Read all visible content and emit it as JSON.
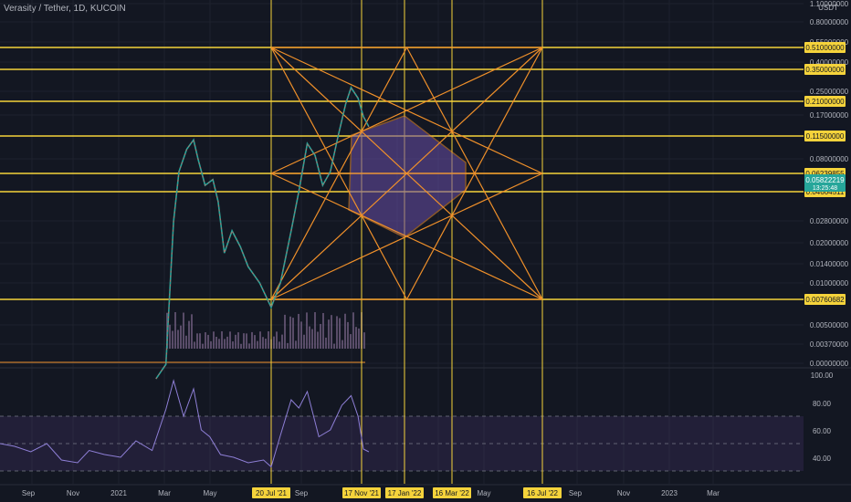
{
  "header": {
    "title": "Verasity / Tether, 1D, KUCOIN",
    "currency": "USDT"
  },
  "colors": {
    "background": "#131722",
    "grid": "#1e222d",
    "level": "#f5d33b",
    "star": "#f0902a",
    "fill": "#6a4fa8",
    "rsi": "#8e7fd6",
    "rsi_band": "#7e57c2",
    "badge_text": "#131722",
    "price_badge": "#26a69a",
    "axis_text": "#b2b5be",
    "volume": "#6b5a7a"
  },
  "chart_data": {
    "type": "line",
    "title": "Verasity / Tether, 1D, KUCOIN",
    "price_axis": {
      "scale": "log",
      "ticks": [
        "1.10000000",
        "0.80000000",
        "0.55000000",
        "0.40000000",
        "0.25000000",
        "0.17000000",
        "0.08000000",
        "0.02800000",
        "0.02000000",
        "0.01400000",
        "0.01000000",
        "0.00500000",
        "0.00370000",
        "0.00000000"
      ]
    },
    "levels": [
      "0.51000000",
      "0.35000000",
      "0.21000000",
      "0.11500000",
      "0.06239855",
      "0.04664511",
      "0.00760682"
    ],
    "current_price": {
      "value": "0.05822219",
      "countdown": "13:25:48"
    },
    "rsi_axis": {
      "ticks": [
        "100.00",
        "80.00",
        "60.00",
        "40.00"
      ],
      "band": [
        30,
        70
      ]
    },
    "time_axis": [
      "Sep",
      "Nov",
      "2021",
      "Mar",
      "May",
      "Sep",
      "Jan",
      "Mar",
      "May",
      "Sep",
      "Nov",
      "2023",
      "Mar"
    ],
    "date_markers": [
      "20 Jul '21",
      "17 Nov '21",
      "17 Jan '22",
      "16 Mar '22",
      "16 Jul '22"
    ],
    "series": [
      {
        "name": "price",
        "points": [
          [
            "2021-02-20",
            0.0034
          ],
          [
            "2021-03-05",
            0.004
          ],
          [
            "2021-03-15",
            0.02
          ],
          [
            "2021-03-22",
            0.035
          ],
          [
            "2021-04-01",
            0.045
          ],
          [
            "2021-04-10",
            0.05
          ],
          [
            "2021-04-16",
            0.04
          ],
          [
            "2021-04-25",
            0.03
          ],
          [
            "2021-05-05",
            0.032
          ],
          [
            "2021-05-12",
            0.025
          ],
          [
            "2021-05-20",
            0.014
          ],
          [
            "2021-05-30",
            0.018
          ],
          [
            "2021-06-10",
            0.015
          ],
          [
            "2021-06-20",
            0.012
          ],
          [
            "2021-07-05",
            0.01
          ],
          [
            "2021-07-20",
            0.0076
          ],
          [
            "2021-08-01",
            0.01
          ],
          [
            "2021-08-15",
            0.018
          ],
          [
            "2021-08-25",
            0.028
          ],
          [
            "2021-09-05",
            0.048
          ],
          [
            "2021-09-15",
            0.042
          ],
          [
            "2021-09-25",
            0.03
          ],
          [
            "2021-10-05",
            0.035
          ],
          [
            "2021-10-15",
            0.052
          ],
          [
            "2021-10-25",
            0.075
          ],
          [
            "2021-11-01",
            0.09
          ],
          [
            "2021-11-10",
            0.08
          ],
          [
            "2021-11-17",
            0.065
          ],
          [
            "2021-11-24",
            0.058
          ]
        ]
      },
      {
        "name": "rsi",
        "points": [
          [
            "2020-08-01",
            50
          ],
          [
            "2020-08-20",
            48
          ],
          [
            "2020-09-10",
            44
          ],
          [
            "2020-10-01",
            50
          ],
          [
            "2020-10-20",
            38
          ],
          [
            "2020-11-10",
            36
          ],
          [
            "2020-11-25",
            45
          ],
          [
            "2020-12-15",
            42
          ],
          [
            "2021-01-05",
            40
          ],
          [
            "2021-01-25",
            52
          ],
          [
            "2021-02-15",
            45
          ],
          [
            "2021-03-05",
            75
          ],
          [
            "2021-03-15",
            96
          ],
          [
            "2021-03-28",
            70
          ],
          [
            "2021-04-10",
            90
          ],
          [
            "2021-04-20",
            60
          ],
          [
            "2021-05-01",
            55
          ],
          [
            "2021-05-15",
            42
          ],
          [
            "2021-06-01",
            40
          ],
          [
            "2021-06-20",
            36
          ],
          [
            "2021-07-10",
            38
          ],
          [
            "2021-07-20",
            33
          ],
          [
            "2021-08-01",
            56
          ],
          [
            "2021-08-15",
            82
          ],
          [
            "2021-08-25",
            76
          ],
          [
            "2021-09-05",
            88
          ],
          [
            "2021-09-20",
            55
          ],
          [
            "2021-10-05",
            60
          ],
          [
            "2021-10-20",
            78
          ],
          [
            "2021-11-01",
            85
          ],
          [
            "2021-11-10",
            70
          ],
          [
            "2021-11-17",
            46
          ],
          [
            "2021-11-24",
            44
          ]
        ]
      }
    ]
  }
}
